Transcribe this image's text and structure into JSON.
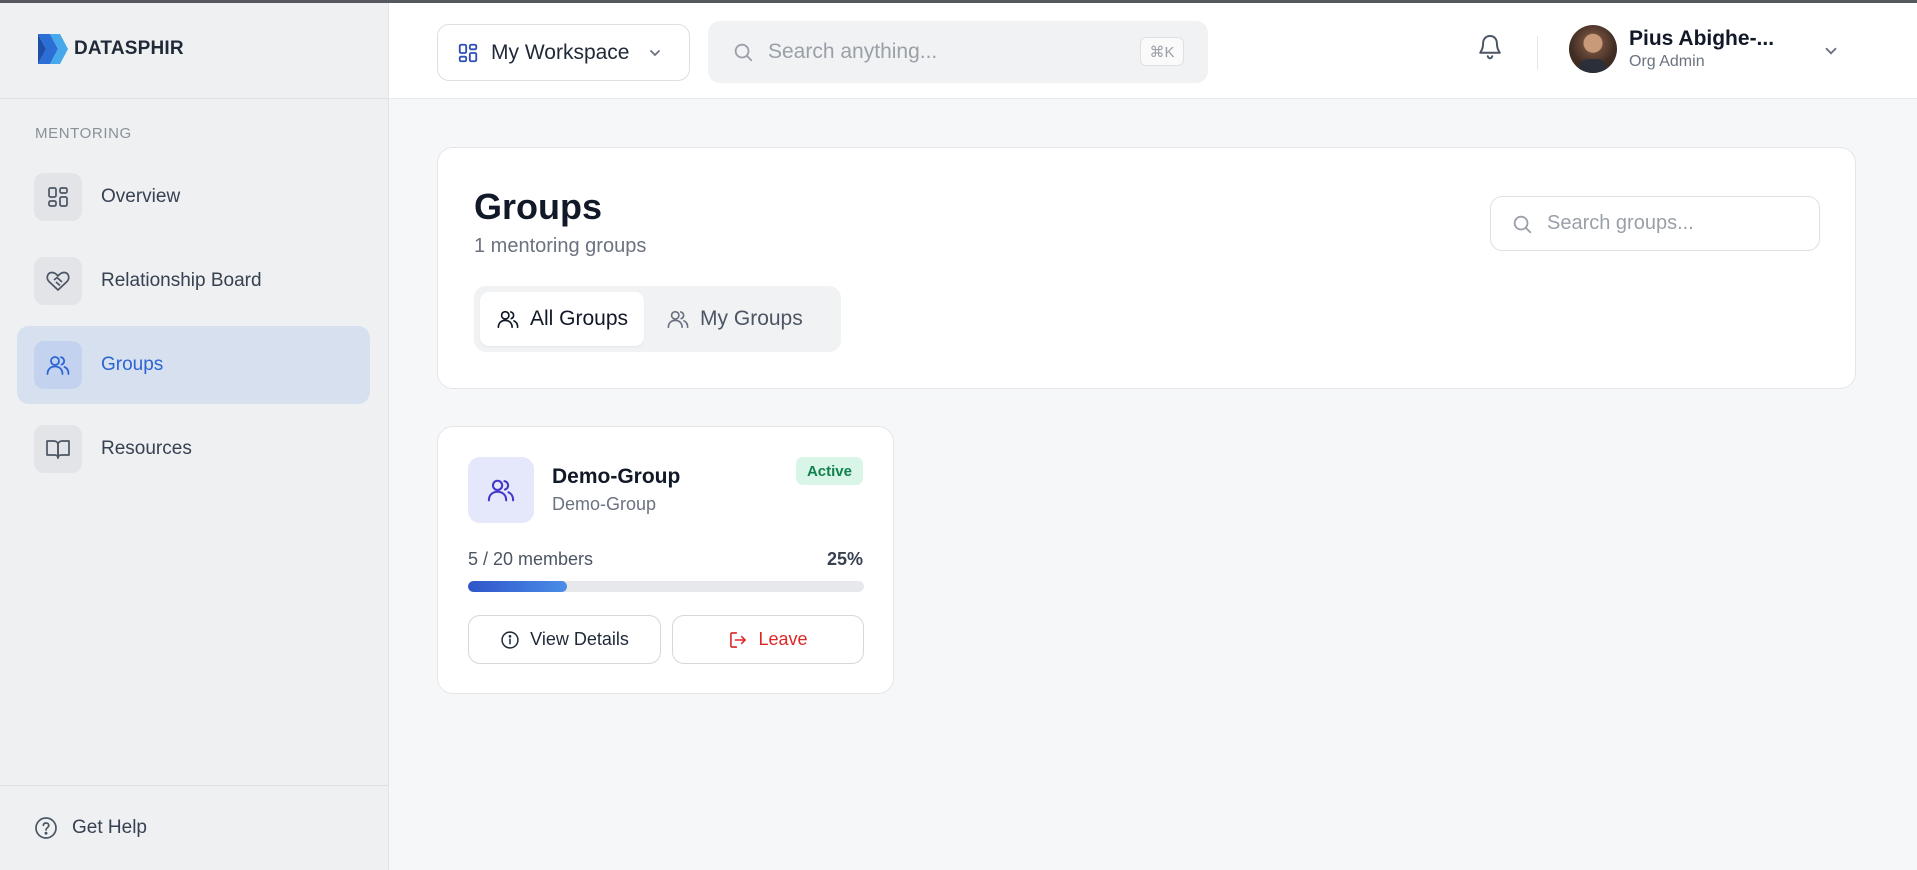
{
  "brand": {
    "name": "DATASPHIR",
    "colors": {
      "accent": "#2d64d4",
      "leave": "#dc2626",
      "active_badge": "#11824f"
    }
  },
  "sidebar": {
    "section_label": "MENTORING",
    "items": [
      {
        "label": "Overview",
        "icon": "grid-icon",
        "active": false
      },
      {
        "label": "Relationship Board",
        "icon": "handshake-heart-icon",
        "active": false
      },
      {
        "label": "Groups",
        "icon": "users-icon",
        "active": true
      },
      {
        "label": "Resources",
        "icon": "book-open-icon",
        "active": false
      }
    ],
    "help_label": "Get Help"
  },
  "topbar": {
    "workspace_label": "My Workspace",
    "search_placeholder": "Search anything...",
    "shortcut": "⌘K",
    "user": {
      "name": "Pius Abighe-...",
      "role": "Org Admin"
    }
  },
  "page": {
    "title": "Groups",
    "subtitle": "1 mentoring groups",
    "search_placeholder": "Search groups...",
    "tabs": [
      {
        "label": "All Groups",
        "active": true
      },
      {
        "label": "My Groups",
        "active": false
      }
    ]
  },
  "groups": [
    {
      "name": "Demo-Group",
      "description": "Demo-Group",
      "status": "Active",
      "members_text": "5 / 20 members",
      "percent_text": "25%",
      "progress": 0.25,
      "details_label": "View Details",
      "leave_label": "Leave"
    }
  ]
}
